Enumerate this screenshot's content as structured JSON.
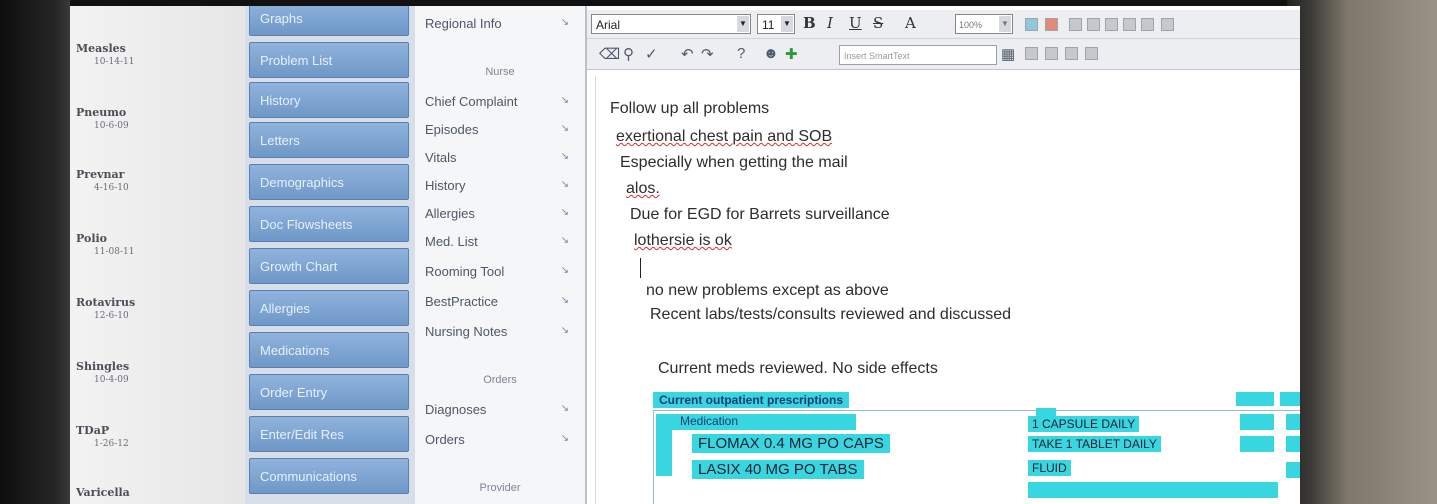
{
  "immunizations": [
    {
      "name": "Measles",
      "date": "10-14-11"
    },
    {
      "name": "Pneumo",
      "date": "10-6-09"
    },
    {
      "name": "Prevnar",
      "date": "4-16-10"
    },
    {
      "name": "Polio",
      "date": "11-08-11"
    },
    {
      "name": "Rotavirus",
      "date": "12-6-10"
    },
    {
      "name": "Shingles",
      "date": "10-4-09"
    },
    {
      "name": "TDaP",
      "date": "1-26-12"
    },
    {
      "name": "Varicella",
      "date": ""
    }
  ],
  "activity_tabs": [
    "Graphs",
    "Problem List",
    "History",
    "Letters",
    "Demographics",
    "Doc Flowsheets",
    "Growth Chart",
    "Allergies",
    "Medications",
    "Order Entry",
    "Enter/Edit Res",
    "Communications"
  ],
  "sections": {
    "top_item": "Regional Info",
    "nurse_header": "Nurse",
    "nurse_items": [
      "Chief Complaint",
      "Episodes",
      "Vitals",
      "History",
      "Allergies",
      "Med. List",
      "Rooming Tool",
      "BestPractice",
      "Nursing Notes"
    ],
    "orders_header": "Orders",
    "orders_items": [
      "Diagnoses",
      "Orders"
    ],
    "provider_header": "Provider"
  },
  "toolbar": {
    "font": "Arial",
    "size": "11",
    "bold": "B",
    "italic": "I",
    "underline": "U",
    "strike": "S",
    "font_color": "A",
    "zoom": "100%",
    "smarttext_placeholder": "Insert SmartText"
  },
  "note": {
    "lines": [
      "Follow up all problems",
      "exertional chest pain and SOB",
      "Especially when getting the mail",
      "alos.",
      "Due for EGD for Barrets surveillance",
      "lothersie is ok",
      "no new problems  except as above",
      "Recent labs/tests/consults reviewed and discussed",
      "Current meds reviewed.  No side effects"
    ],
    "meds_title": "Current outpatient prescriptions",
    "meds_col_header": "Medication",
    "medications": [
      {
        "name": "FLOMAX 0.4 MG PO CAPS",
        "sig": "1 CAPSULE DAILY"
      },
      {
        "name": "LASIX 40 MG PO TABS",
        "sig": "TAKE 1 TABLET DAILY"
      }
    ],
    "extra_sig": "FLUID"
  },
  "colors": {
    "tab_blue": "#7aa2d0",
    "highlight_cyan": "#38d6e0"
  }
}
